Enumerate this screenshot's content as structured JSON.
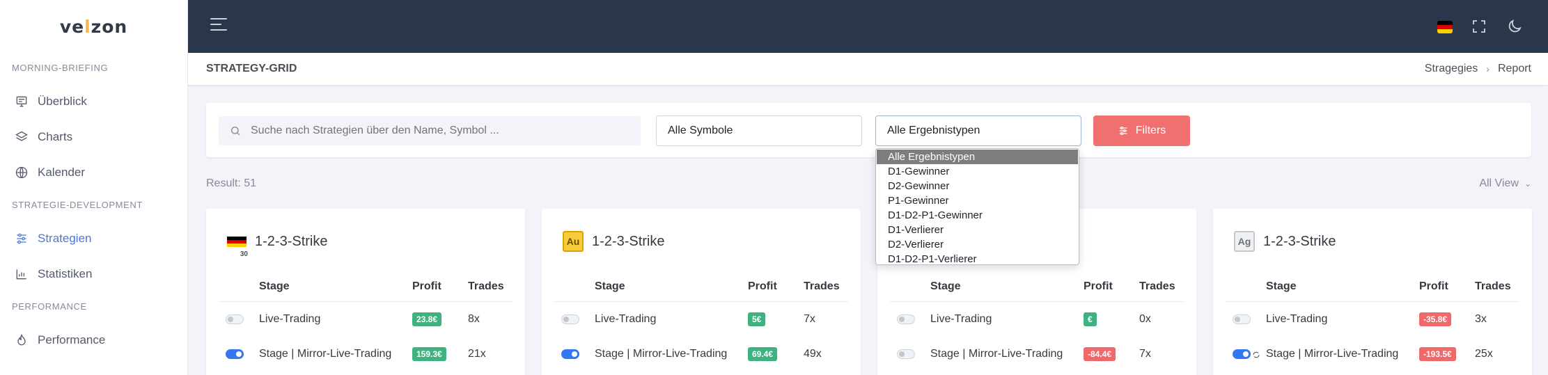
{
  "app": {
    "logo": "velzon",
    "logo_dot": "."
  },
  "sidebar": {
    "sections": [
      {
        "title": "MORNING-BRIEFING",
        "items": [
          {
            "label": "Überblick",
            "icon": "monitor-icon"
          },
          {
            "label": "Charts",
            "icon": "layers-icon"
          },
          {
            "label": "Kalender",
            "icon": "globe-icon"
          }
        ]
      },
      {
        "title": "STRATEGIE-DEVELOPMENT",
        "items": [
          {
            "label": "Strategien",
            "icon": "sliders-icon",
            "active": true
          },
          {
            "label": "Statistiken",
            "icon": "chart-icon"
          }
        ]
      },
      {
        "title": "PERFORMANCE",
        "items": [
          {
            "label": "Performance",
            "icon": "flame-icon"
          }
        ]
      }
    ]
  },
  "page": {
    "title": "STRATEGY-GRID",
    "breadcrumb": [
      "Stragegies",
      "Report"
    ]
  },
  "filters": {
    "search_placeholder": "Suche nach Strategien über den Name, Symbol ...",
    "symbol_select": "Alle Symbole",
    "result_type_select": "Alle Ergebnistypen",
    "filters_button": "Filters",
    "result_text": "Result: 51",
    "view_label": "All View",
    "dropdown_options": [
      "Alle Ergebnistypen",
      "D1-Gewinner",
      "D2-Gewinner",
      "P1-Gewinner",
      "D1-D2-P1-Gewinner",
      "D1-Verlierer",
      "D2-Verlierer",
      "D1-D2-P1-Verlierer"
    ],
    "dropdown_selected": "Alle Ergebnistypen"
  },
  "table_headers": {
    "stage": "Stage",
    "profit": "Profit",
    "trades": "Trades"
  },
  "cards": [
    {
      "title": "1-2-3-Strike",
      "symbol": "DE30",
      "symbol_label": "30",
      "rows": [
        {
          "stage": "Live-Trading",
          "on": false,
          "profit": "23.8€",
          "positive": true,
          "trades": "8x"
        },
        {
          "stage": "Stage | Mirror-Live-Trading",
          "on": true,
          "profit": "159.3€",
          "positive": true,
          "trades": "21x"
        }
      ]
    },
    {
      "title": "1-2-3-Strike",
      "symbol": "Au",
      "symbol_label": "Au",
      "rows": [
        {
          "stage": "Live-Trading",
          "on": false,
          "profit": "5€",
          "positive": true,
          "trades": "7x"
        },
        {
          "stage": "Stage | Mirror-Live-Trading",
          "on": true,
          "profit": "69.4€",
          "positive": true,
          "trades": "49x"
        }
      ]
    },
    {
      "title": "",
      "symbol": "",
      "symbol_label": "",
      "rows": [
        {
          "stage": "Live-Trading",
          "on": false,
          "profit": "€",
          "positive": true,
          "trades": "0x"
        },
        {
          "stage": "Stage | Mirror-Live-Trading",
          "on": false,
          "profit": "-84.4€",
          "positive": false,
          "trades": "7x"
        }
      ]
    },
    {
      "title": "1-2-3-Strike",
      "symbol": "Ag",
      "symbol_label": "Ag",
      "rows": [
        {
          "stage": "Live-Trading",
          "on": false,
          "profit": "-35.8€",
          "positive": false,
          "trades": "3x"
        },
        {
          "stage": "Stage | Mirror-Live-Trading",
          "on": true,
          "profit": "-193.5€",
          "positive": false,
          "trades": "25x"
        }
      ]
    }
  ],
  "colors": {
    "topbar": "#2a3649",
    "accent": "#4b78d4",
    "danger": "#f07070",
    "success": "#3fb27f"
  }
}
